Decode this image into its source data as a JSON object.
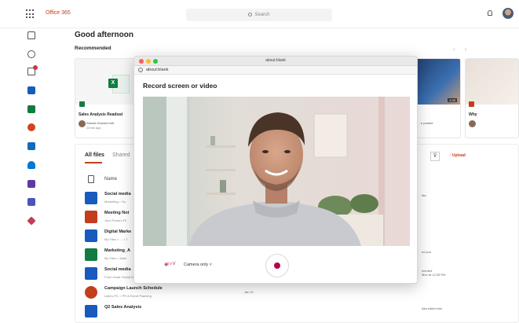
{
  "topbar": {
    "brand": "Office 365",
    "search_placeholder": "Search"
  },
  "main": {
    "greeting": "Good afternoon",
    "recommended_label": "Recommended",
    "nav_prev": "‹",
    "nav_next": "›",
    "cards": [
      {
        "title": "Sales Analysis Readout",
        "meta": "Wanda Howard edit",
        "time": "20min ago"
      },
      {
        "title": "al",
        "meta": "e posted",
        "duration": "2:33"
      },
      {
        "title": "Why"
      }
    ]
  },
  "files": {
    "tab_all": "All files",
    "tab_shared": "Shared",
    "upload_label": "Upload",
    "col_name": "Name",
    "rows": [
      {
        "name": "Social media",
        "sub": "Marketing > So",
        "date": "",
        "activity": "dta",
        "icon_color": "#185abd"
      },
      {
        "name": "Meeting Not",
        "sub": "John Frank's Fil",
        "date": "",
        "activity": "",
        "icon_color": "#c43e1c"
      },
      {
        "name": "Digital Marke",
        "sub": "My Files > ... > T",
        "date": "",
        "activity": "",
        "icon_color": "#185abd"
      },
      {
        "name": "Marketing_A",
        "sub": "My Files > Mark",
        "date": "",
        "activity": "ed you",
        "icon_color": "#107c41"
      },
      {
        "name": "Social media",
        "sub": "From email: Social Media",
        "date": "",
        "activity": "mented\nMon at 12:35 PM",
        "icon_color": "#185abd"
      },
      {
        "name": "Campaign Launch Schedule",
        "sub": "Lidia's PC > PR & Event Planning",
        "date": "Jan 21",
        "activity": "",
        "icon_color": "#c43e1c"
      },
      {
        "name": "Q2 Sales Analysis",
        "sub": "",
        "date": "",
        "activity": "Alla edited this",
        "icon_color": "#185abd"
      }
    ]
  },
  "popup": {
    "window_title": "about:blank",
    "url": "about:blank",
    "heading": "Record screen or video",
    "camera_select": "Camera only"
  },
  "colors": {
    "accent": "#c43e1c",
    "record": "#b4004e"
  }
}
